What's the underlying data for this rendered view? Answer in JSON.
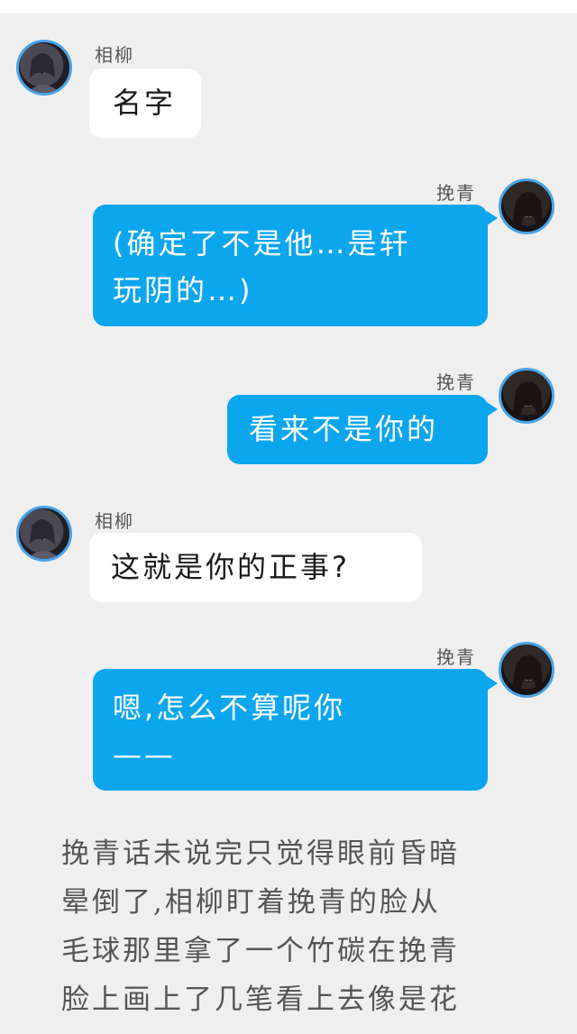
{
  "chat": {
    "messages": [
      {
        "sender": "相柳",
        "text": "名字",
        "side": "left"
      },
      {
        "sender": "挽青",
        "line1": "(确定了不是他…是轩",
        "line2": "玩阴的…)",
        "side": "right"
      },
      {
        "sender": "挽青",
        "text": "看来不是你的",
        "side": "right"
      },
      {
        "sender": "相柳",
        "text": "这就是你的正事?",
        "side": "left"
      },
      {
        "sender": "挽青",
        "line1": "嗯,怎么不算呢你",
        "line2": "——",
        "side": "right"
      }
    ]
  },
  "narration": {
    "lines": [
      "挽青话未说完只觉得眼前昏暗",
      "晕倒了,相柳盯着挽青的脸从",
      "毛球那里拿了一个竹碳在挽青",
      "脸上画上了几笔看上去像是花"
    ]
  },
  "colors": {
    "background": "#efefef",
    "bubble_blue": "#0ca6ee",
    "avatar_ring": "#4aa3e8"
  }
}
